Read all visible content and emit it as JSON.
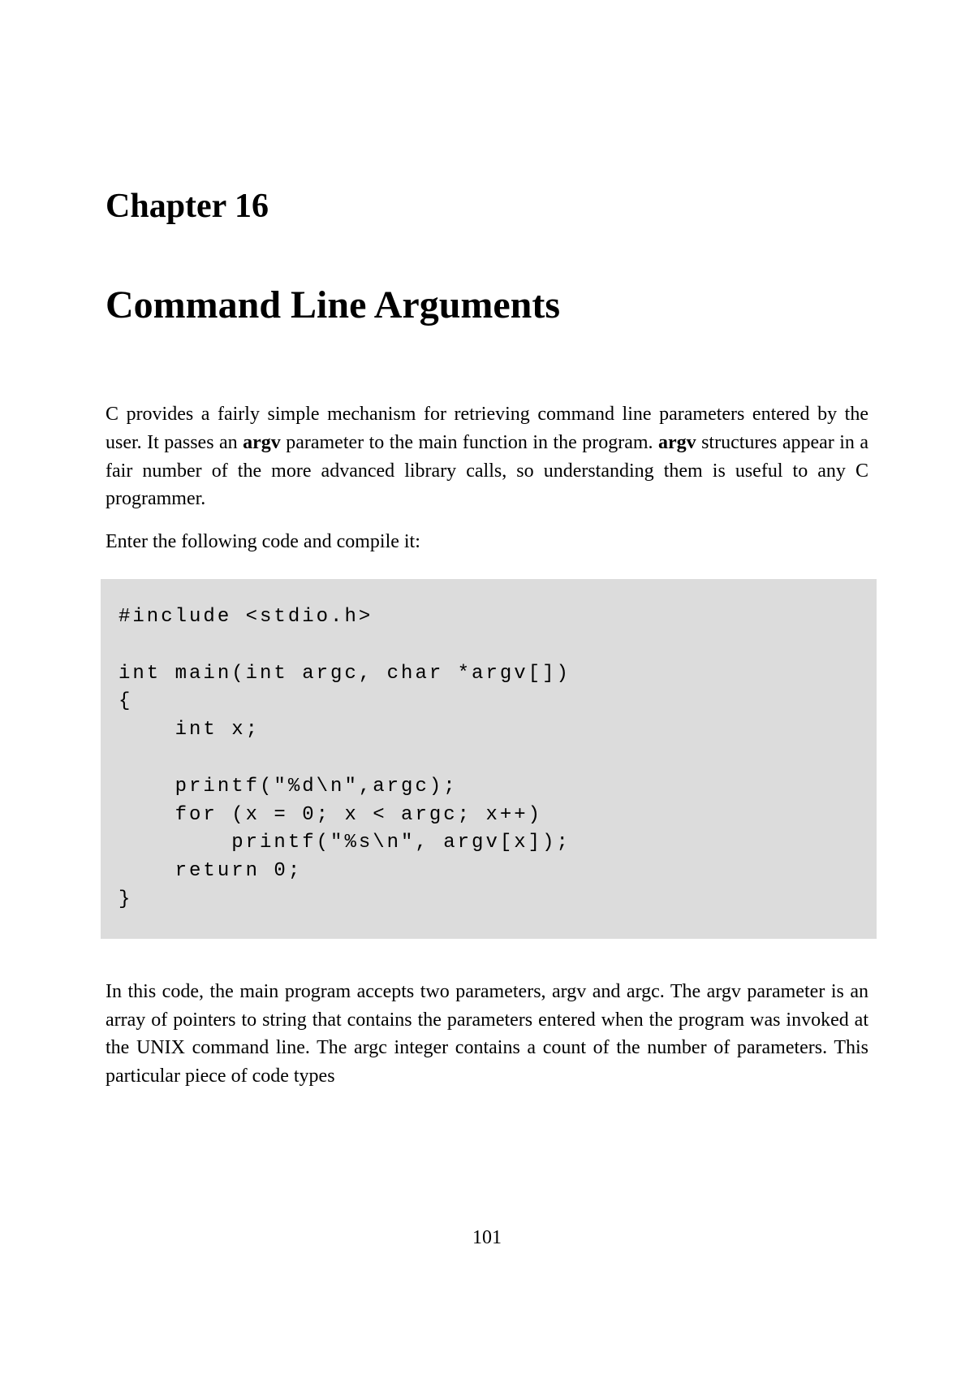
{
  "chapter": {
    "number": "Chapter 16",
    "title": "Command Line Arguments"
  },
  "paragraphs": {
    "p1_part1": "C provides a fairly simple mechanism for retrieving command line parameters entered by the user. It passes an ",
    "p1_bold1": "argv",
    "p1_part2": " parameter to the main function in the program. ",
    "p1_bold2": "argv",
    "p1_part3": " structures appear in a fair number of the more advanced library calls, so understanding them is useful to any C programmer.",
    "p2": "Enter the following code and compile it:",
    "p3": "In this code, the main program accepts two parameters, argv and argc. The argv parameter is an array of pointers to string that contains the parameters entered when the program was invoked at the UNIX command line. The argc integer contains a count of the number of parameters. This particular piece of code types"
  },
  "code": "#include <stdio.h>\n\nint main(int argc, char *argv[])\n{\n    int x;\n\n    printf(\"%d\\n\",argc);\n    for (x = 0; x < argc; x++)\n        printf(\"%s\\n\", argv[x]);\n    return 0;\n}",
  "pageNumber": "101"
}
